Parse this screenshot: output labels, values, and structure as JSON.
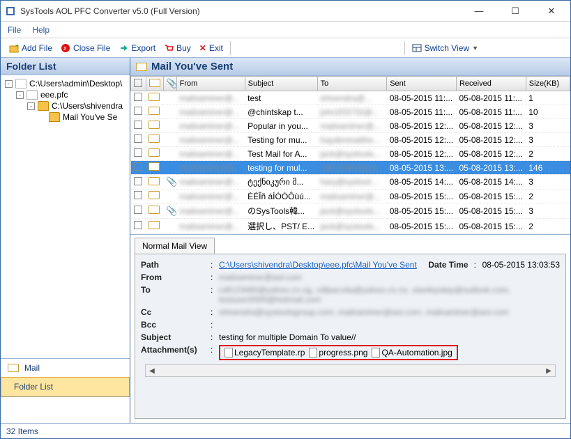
{
  "title": "SysTools  AOL PFC Converter v5.0 (Full Version)",
  "menubar": {
    "file": "File",
    "help": "Help"
  },
  "toolbar": {
    "add_file": "Add File",
    "close_file": "Close File",
    "export": "Export",
    "buy": "Buy",
    "exit": "Exit",
    "switch_view": "Switch View"
  },
  "left": {
    "header": "Folder List",
    "nodes": [
      {
        "indent": 0,
        "exp": "-",
        "open": true,
        "label": "C:\\Users\\admin\\Desktop\\"
      },
      {
        "indent": 1,
        "exp": "-",
        "open": true,
        "label": "eee.pfc"
      },
      {
        "indent": 2,
        "exp": "-",
        "open": false,
        "label": "C:\\Users\\shivendra"
      },
      {
        "indent": 3,
        "exp": "",
        "open": false,
        "label": "Mail You've Se"
      }
    ],
    "nav_mail": "Mail",
    "nav_folder": "Folder List"
  },
  "right": {
    "header": "Mail You've Sent",
    "columns": [
      "",
      "",
      "",
      "From",
      "Subject",
      "To",
      "Sent",
      "Received",
      "Size(KB)"
    ],
    "rows": [
      {
        "sel": false,
        "att": "",
        "from": "mailxaminer@...",
        "subject": "test",
        "to": "shivendra@...",
        "sent": "08-05-2015 11:...",
        "recv": "05-08-2015 11:...",
        "size": "1"
      },
      {
        "sel": false,
        "att": "",
        "from": "mailxaminer@...",
        "subject": "@chintskap t...",
        "to": "john203732@...",
        "sent": "08-05-2015 11:...",
        "recv": "05-08-2015 11:...",
        "size": "10"
      },
      {
        "sel": false,
        "att": "",
        "from": "mailxaminer@...",
        "subject": "Popular in you...",
        "to": "mailxaminer@...",
        "sent": "08-05-2015 12:...",
        "recv": "05-08-2015 12:...",
        "size": "3"
      },
      {
        "sel": false,
        "att": "",
        "from": "mailxaminer@...",
        "subject": "Testing for mu...",
        "to": "haydenmatthe...",
        "sent": "08-05-2015 12:...",
        "recv": "05-08-2015 12:...",
        "size": "3"
      },
      {
        "sel": false,
        "att": "",
        "from": "mailxaminer@...",
        "subject": "Test Mail for A...",
        "to": "jack@systools...",
        "sent": "08-05-2015 12:...",
        "recv": "05-08-2015 12:...",
        "size": "2"
      },
      {
        "sel": true,
        "att": "",
        "from": "mailxaminer@...",
        "subject": "testing for mul...",
        "to": "cdf123460@ya...",
        "sent": "08-05-2015 13:...",
        "recv": "05-08-2015 13:...",
        "size": "146"
      },
      {
        "sel": false,
        "att": "📎",
        "from": "mailxaminer@...",
        "subject": "ტექნიკური მ...",
        "to": "hary@systool...",
        "sent": "08-05-2015 14:...",
        "recv": "05-08-2015 14:...",
        "size": "3"
      },
      {
        "sel": false,
        "att": "",
        "from": "mailxaminer@...",
        "subject": "ÈÉÎñ áÍÓÒÔùú...",
        "to": "mailxaminer@...",
        "sent": "08-05-2015 15:...",
        "recv": "05-08-2015 15:...",
        "size": "2"
      },
      {
        "sel": false,
        "att": "📎",
        "from": "mailxaminer@...",
        "subject": "のSysTools韓...",
        "to": "jack@systools...",
        "sent": "08-05-2015 15:...",
        "recv": "05-08-2015 15:...",
        "size": "3"
      },
      {
        "sel": false,
        "att": "",
        "from": "mailxaminer@...",
        "subject": "選択し、PST/ E...",
        "to": "jack@systools...",
        "sent": "08-05-2015 15:...",
        "recv": "05-08-2015 15:...",
        "size": "2"
      }
    ]
  },
  "preview": {
    "tab": "Normal Mail View",
    "labels": {
      "path": "Path",
      "datetime": "Date Time",
      "from": "From",
      "to": "To",
      "cc": "Cc",
      "bcc": "Bcc",
      "subject": "Subject",
      "att": "Attachment(s)"
    },
    "path": "C:\\Users\\shivendra\\Desktop\\eee.pfc\\Mail You've Sent",
    "datetime": "08-05-2015 13:03:53",
    "from": "mailxaminer@aol.com",
    "to": "cdf123460@yahoo.co.sg, cdfpacvita@yahoo.co.nz, stanleystep@outlook.com, testuser0000@hotmail.com",
    "cc": "shivendra@systoolsgroup.com, mailxaminer@aol.com, mailxaminer@aol.com",
    "bcc": "",
    "subject": "testing for multiple Domain To value//",
    "attachments": [
      "LegacyTemplate.rp",
      "progress.png",
      "QA-Automation.jpg"
    ]
  },
  "status": "32 Items"
}
